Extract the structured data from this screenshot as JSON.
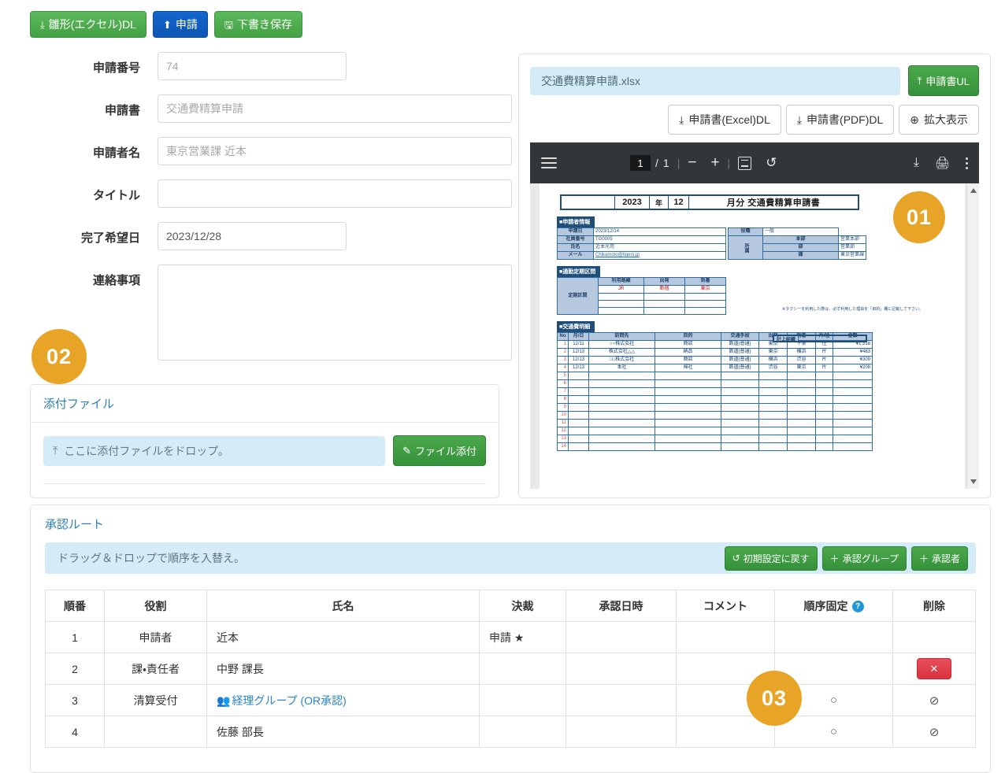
{
  "toolbar": {
    "template_dl": "雛形(エクセル)DL",
    "apply": "申請",
    "save_draft": "下書き保存"
  },
  "form": {
    "fields": [
      {
        "label": "申請番号",
        "value": "74",
        "placeholder": ""
      },
      {
        "label": "申請書",
        "value": "交通費精算申請",
        "placeholder": ""
      },
      {
        "label": "申請者名",
        "value": "東京営業課 近本",
        "placeholder": ""
      },
      {
        "label": "タイトル",
        "value": "",
        "placeholder": ""
      },
      {
        "label": "完了希望日",
        "value": "2023/12/28",
        "placeholder": ""
      },
      {
        "label": "連絡事項",
        "value": "",
        "placeholder": ""
      }
    ]
  },
  "attachment": {
    "title": "添付ファイル",
    "drop_text": "ここに添付ファイルをドロップ。",
    "attach_button": "ファイル添付"
  },
  "preview": {
    "file_name": "交通費精算申請.xlsx",
    "upload_button": "申請書UL",
    "excel_dl": "申請書(Excel)DL",
    "pdf_dl": "申請書(PDF)DL",
    "zoom_view": "拡大表示",
    "pdf_toolbar": {
      "current_page": "1",
      "page_divider": "/",
      "total_pages": "1",
      "zoom_out": "−",
      "zoom_in": "+"
    }
  },
  "document": {
    "title_year": "2023",
    "title_year_label": "年",
    "title_month": "12",
    "title_month_label": "月分",
    "title_main": "交通費精算申請書",
    "applicant_section": "■申請者情報",
    "applicant_rows": [
      {
        "label": "申請日",
        "value": "2023/12/14"
      },
      {
        "label": "社員番号",
        "value": "TG0005"
      },
      {
        "label": "氏名",
        "value": "近本光司"
      },
      {
        "label": "メール",
        "value": "Chikamoto@tigers.jp"
      }
    ],
    "org_rows": [
      {
        "label": "役職",
        "value": "一般"
      },
      {
        "label": "本部",
        "value": "営業本部"
      },
      {
        "label": "部",
        "value": "営業部"
      },
      {
        "label": "課",
        "value": "東京営業課"
      }
    ],
    "org_side_label": "所属",
    "pass_section": "■通勤定期区間",
    "pass_headers": [
      "利用路線",
      "出発",
      "到着"
    ],
    "pass_row_label": "定期区間",
    "pass_rows": [
      [
        "JR",
        "新宿",
        "東京"
      ],
      [
        "",
        "",
        ""
      ],
      [
        "",
        "",
        ""
      ],
      [
        "",
        "",
        ""
      ]
    ],
    "note": "※タクシーを利用した際は、必ず利用した理由を「目的」欄に記載して下さい。",
    "keijyo_label": "計上組織",
    "keijyo_value": "",
    "detail_section": "■交通費明細",
    "detail_headers": [
      "No",
      "月/日",
      "訪問先",
      "目的",
      "交通手段",
      "出発",
      "到着",
      "片/往",
      "金額"
    ],
    "detail_rows": [
      [
        "1",
        "12/11",
        "○○株式会社",
        "商談",
        "鉄道(普通)",
        "東京",
        "千葉",
        "往",
        "¥1,318"
      ],
      [
        "2",
        "12/13",
        "株式会社△△",
        "納品",
        "鉄道(普通)",
        "東京",
        "横浜",
        "片",
        "¥483"
      ],
      [
        "3",
        "12/13",
        "□□株式会社",
        "商談",
        "鉄道(普通)",
        "横浜",
        "渋谷",
        "片",
        "¥309"
      ],
      [
        "4",
        "12/13",
        "本社",
        "帰社",
        "鉄道(普通)",
        "渋谷",
        "東京",
        "片",
        "¥208"
      ],
      [
        "5",
        "",
        "",
        "",
        "",
        "",
        "",
        "",
        ""
      ],
      [
        "6",
        "",
        "",
        "",
        "",
        "",
        "",
        "",
        ""
      ],
      [
        "7",
        "",
        "",
        "",
        "",
        "",
        "",
        "",
        ""
      ],
      [
        "8",
        "",
        "",
        "",
        "",
        "",
        "",
        "",
        ""
      ],
      [
        "9",
        "",
        "",
        "",
        "",
        "",
        "",
        "",
        ""
      ],
      [
        "10",
        "",
        "",
        "",
        "",
        "",
        "",
        "",
        ""
      ],
      [
        "11",
        "",
        "",
        "",
        "",
        "",
        "",
        "",
        ""
      ],
      [
        "12",
        "",
        "",
        "",
        "",
        "",
        "",
        "",
        ""
      ],
      [
        "13",
        "",
        "",
        "",
        "",
        "",
        "",
        "",
        ""
      ],
      [
        "14",
        "",
        "",
        "",
        "",
        "",
        "",
        "",
        ""
      ]
    ]
  },
  "route": {
    "title": "承認ルート",
    "hint": "ドラッグ＆ドロップで順序を入替え。",
    "reset_button": "初期設定に戻す",
    "add_group_button": "承認グループ",
    "add_approver_button": "承認者",
    "headers": {
      "order": "順番",
      "role": "役割",
      "name": "氏名",
      "decision": "決裁",
      "approved_at": "承認日時",
      "comment": "コメント",
      "fixed": "順序固定",
      "delete": "削除"
    },
    "rows": [
      {
        "order": "1",
        "role": "申請者",
        "name": "近本",
        "name_is_link": false,
        "decision": "申請 ★",
        "approved_at": "",
        "comment": "",
        "fixed": "",
        "delete_kind": "none"
      },
      {
        "order": "2",
        "role": "課・責任者",
        "name": "中野 課長",
        "name_is_link": false,
        "decision": "",
        "approved_at": "",
        "comment": "",
        "fixed": "",
        "delete_kind": "button"
      },
      {
        "order": "3",
        "role": "清算受付",
        "name": "経理グループ (OR承認)",
        "name_is_link": true,
        "decision": "",
        "approved_at": "",
        "comment": "",
        "fixed": "○",
        "delete_kind": "disabled"
      },
      {
        "order": "4",
        "role": "",
        "name": "佐藤 部長",
        "name_is_link": false,
        "decision": "",
        "approved_at": "",
        "comment": "",
        "fixed": "○",
        "delete_kind": "disabled"
      }
    ],
    "delete_button_label": "✕",
    "disabled_delete_symbol": "⊘"
  },
  "badges": {
    "one": "01",
    "two": "02",
    "three": "03"
  },
  "colors": {
    "badge_orange": "#E8A427",
    "primary_green": "#4BA94B",
    "primary_blue": "#0D56B3",
    "link_blue": "#2B86C5",
    "info_bg": "#D4ECF7",
    "danger_red": "#D9333F"
  }
}
